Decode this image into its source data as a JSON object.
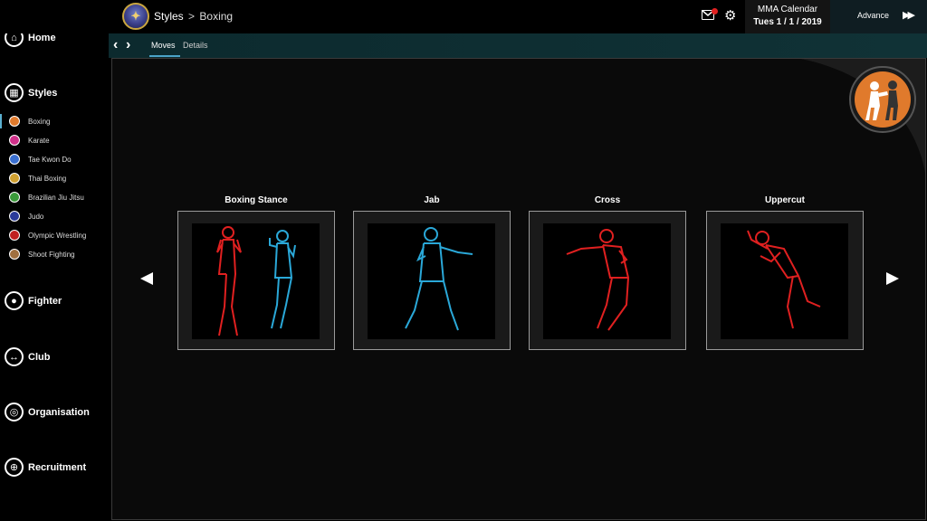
{
  "header": {
    "breadcrumb": {
      "section": "Styles",
      "separator": ">",
      "current": "Boxing"
    },
    "mail_icon": "envelope-icon",
    "settings_icon": "gear-icon",
    "calendar": {
      "title": "MMA Calendar",
      "date": "Tues 1 / 1 / 2019"
    },
    "advance": {
      "label": "Advance",
      "icon": "fast-forward-icon"
    }
  },
  "sidebar": {
    "main_items": [
      {
        "label": "Home",
        "icon": "home-icon"
      },
      {
        "label": "Styles",
        "icon": "grid-icon"
      },
      {
        "label": "Fighter",
        "icon": "person-icon"
      },
      {
        "label": "Club",
        "icon": "dumbbell-icon"
      },
      {
        "label": "Organisation",
        "icon": "globe-icon"
      },
      {
        "label": "Recruitment",
        "icon": "target-icon"
      }
    ],
    "styles": [
      {
        "label": "Boxing",
        "color": "#e07a2c"
      },
      {
        "label": "Karate",
        "color": "#d0308a"
      },
      {
        "label": "Tae Kwon Do",
        "color": "#3a6fd0"
      },
      {
        "label": "Thai Boxing",
        "color": "#d0a030"
      },
      {
        "label": "Brazilian Jiu Jitsu",
        "color": "#3a9a3a"
      },
      {
        "label": "Judo",
        "color": "#2a3a9a"
      },
      {
        "label": "Olympic Wrestling",
        "color": "#c02020"
      },
      {
        "label": "Shoot Fighting",
        "color": "#a07040"
      }
    ],
    "active_style": "Boxing"
  },
  "subheader": {
    "tabs": [
      {
        "label": "Moves",
        "active": true
      },
      {
        "label": "Details",
        "active": false
      }
    ]
  },
  "moves": [
    {
      "title": "Boxing Stance",
      "colors": [
        "#e02020",
        "#2aa8d8"
      ]
    },
    {
      "title": "Jab",
      "colors": [
        "#2aa8d8"
      ]
    },
    {
      "title": "Cross",
      "colors": [
        "#e02020"
      ]
    },
    {
      "title": "Uppercut",
      "colors": [
        "#e02020"
      ]
    }
  ],
  "theme": {
    "accent": "#4ba3c8",
    "style_color": "#e07a2c"
  }
}
